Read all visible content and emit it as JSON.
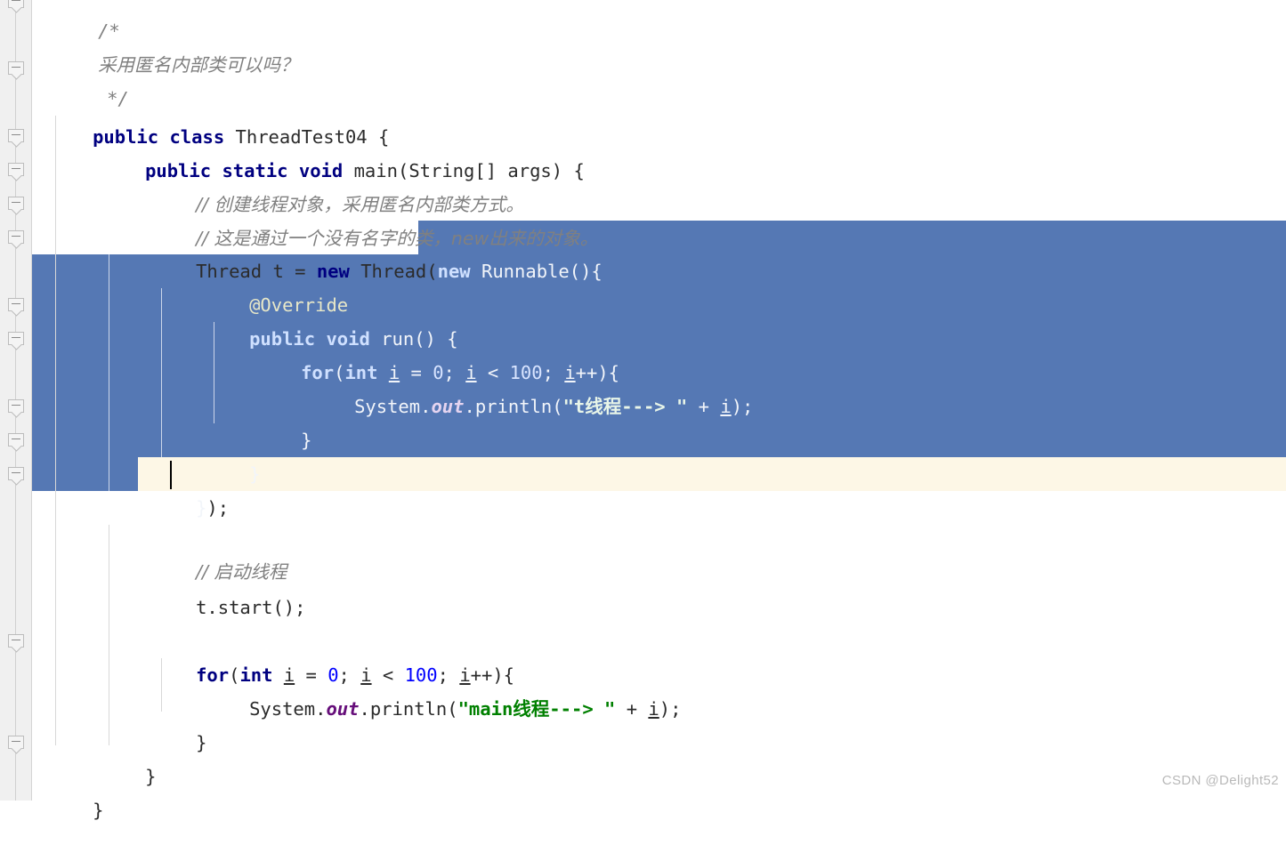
{
  "editor": {
    "app": "java-code-editor",
    "watermark": "CSDN @Delight52",
    "colors": {
      "background": "#ffffff",
      "gutter": "#f0f0f0",
      "selection": "#5578b4",
      "caret_line": "#fdf7e6",
      "keyword": "#000080",
      "comment": "#808080",
      "string": "#008000",
      "number": "#0000ff",
      "static_field": "#660e7a",
      "annotation": "#808000",
      "watermark_text": "#b9b9b9"
    },
    "file_class_name": "ThreadTest04",
    "caret_line_number": 13,
    "selection_active": true
  },
  "lines": [
    {
      "n": 1,
      "indent": 0,
      "text": "/*",
      "fold": true
    },
    {
      "n": 2,
      "indent": 1,
      "text": "采用匿名内部类可以吗？",
      "kind": "comment"
    },
    {
      "n": 3,
      "indent": 1,
      "text": "*/",
      "fold": true
    },
    {
      "n": 4,
      "indent": 0,
      "text": "public class ThreadTest04 {"
    },
    {
      "n": 5,
      "indent": 1,
      "text": "public static void main(String[] args) {",
      "fold": true
    },
    {
      "n": 6,
      "indent": 2,
      "text": "// 创建线程对象，采用匿名内部类方式。",
      "kind": "comment",
      "fold": true
    },
    {
      "n": 7,
      "indent": 2,
      "text": "// 这是通过一个没有名字的类，new出来的对象。",
      "kind": "comment",
      "fold": true
    },
    {
      "n": 8,
      "indent": 2,
      "text": "Thread t = new Thread(new Runnable(){",
      "fold": true
    },
    {
      "n": 9,
      "indent": 3,
      "text": "@Override",
      "selected": true
    },
    {
      "n": 10,
      "indent": 3,
      "text": "public void run() {",
      "selected": true,
      "fold": true
    },
    {
      "n": 11,
      "indent": 4,
      "text": "for(int i = 0; i < 100; i++){",
      "selected": true,
      "fold": true
    },
    {
      "n": 12,
      "indent": 5,
      "text": "System.out.println(\"t线程---> \" + i);",
      "selected": true
    },
    {
      "n": 13,
      "indent": 4,
      "text": "}",
      "selected": true
    },
    {
      "n": 14,
      "indent": 3,
      "text": "}",
      "selected": true
    },
    {
      "n": 15,
      "indent": 2,
      "text": "});",
      "caret": true,
      "fold": true
    },
    {
      "n": 16,
      "indent": 0,
      "text": ""
    },
    {
      "n": 17,
      "indent": 2,
      "text": "// 启动线程",
      "kind": "comment"
    },
    {
      "n": 18,
      "indent": 2,
      "text": "t.start();"
    },
    {
      "n": 19,
      "indent": 0,
      "text": ""
    },
    {
      "n": 20,
      "indent": 2,
      "text": "for(int i = 0; i < 100; i++){",
      "fold": true
    },
    {
      "n": 21,
      "indent": 3,
      "text": "System.out.println(\"main线程---> \" + i);"
    },
    {
      "n": 22,
      "indent": 2,
      "text": "}"
    },
    {
      "n": 23,
      "indent": 1,
      "text": "}",
      "fold": true
    },
    {
      "n": 24,
      "indent": 0,
      "text": "}"
    }
  ],
  "tokens": {
    "kw_public": "public",
    "kw_class": "class",
    "kw_static": "static",
    "kw_void": "void",
    "kw_new": "new",
    "kw_int": "int",
    "kw_for": "for",
    "type_thread": "Thread",
    "type_string": "String",
    "type_runnable": "Runnable",
    "ident_main": "main",
    "ident_args": "args",
    "ident_t": "t",
    "ident_i": "i",
    "ident_run": "run",
    "ident_system": "System",
    "ident_out": "out",
    "ident_println": "println",
    "ident_start": "start",
    "annotation_override": "@Override",
    "literal_zero": "0",
    "literal_hundred": "100",
    "string_t_thread": "\"t线程---> \"",
    "string_main_thread": "\"main线程---> \"",
    "comment_anon_q": "采用匿名内部类可以吗？",
    "comment_create": "// 创建线程对象，采用匿名内部类方式。",
    "comment_noname": "// 这是通过一个没有名字的类，new出来的对象。",
    "comment_start_thread": "// 启动线程",
    "block_open": "/*",
    "block_close": "*/"
  }
}
